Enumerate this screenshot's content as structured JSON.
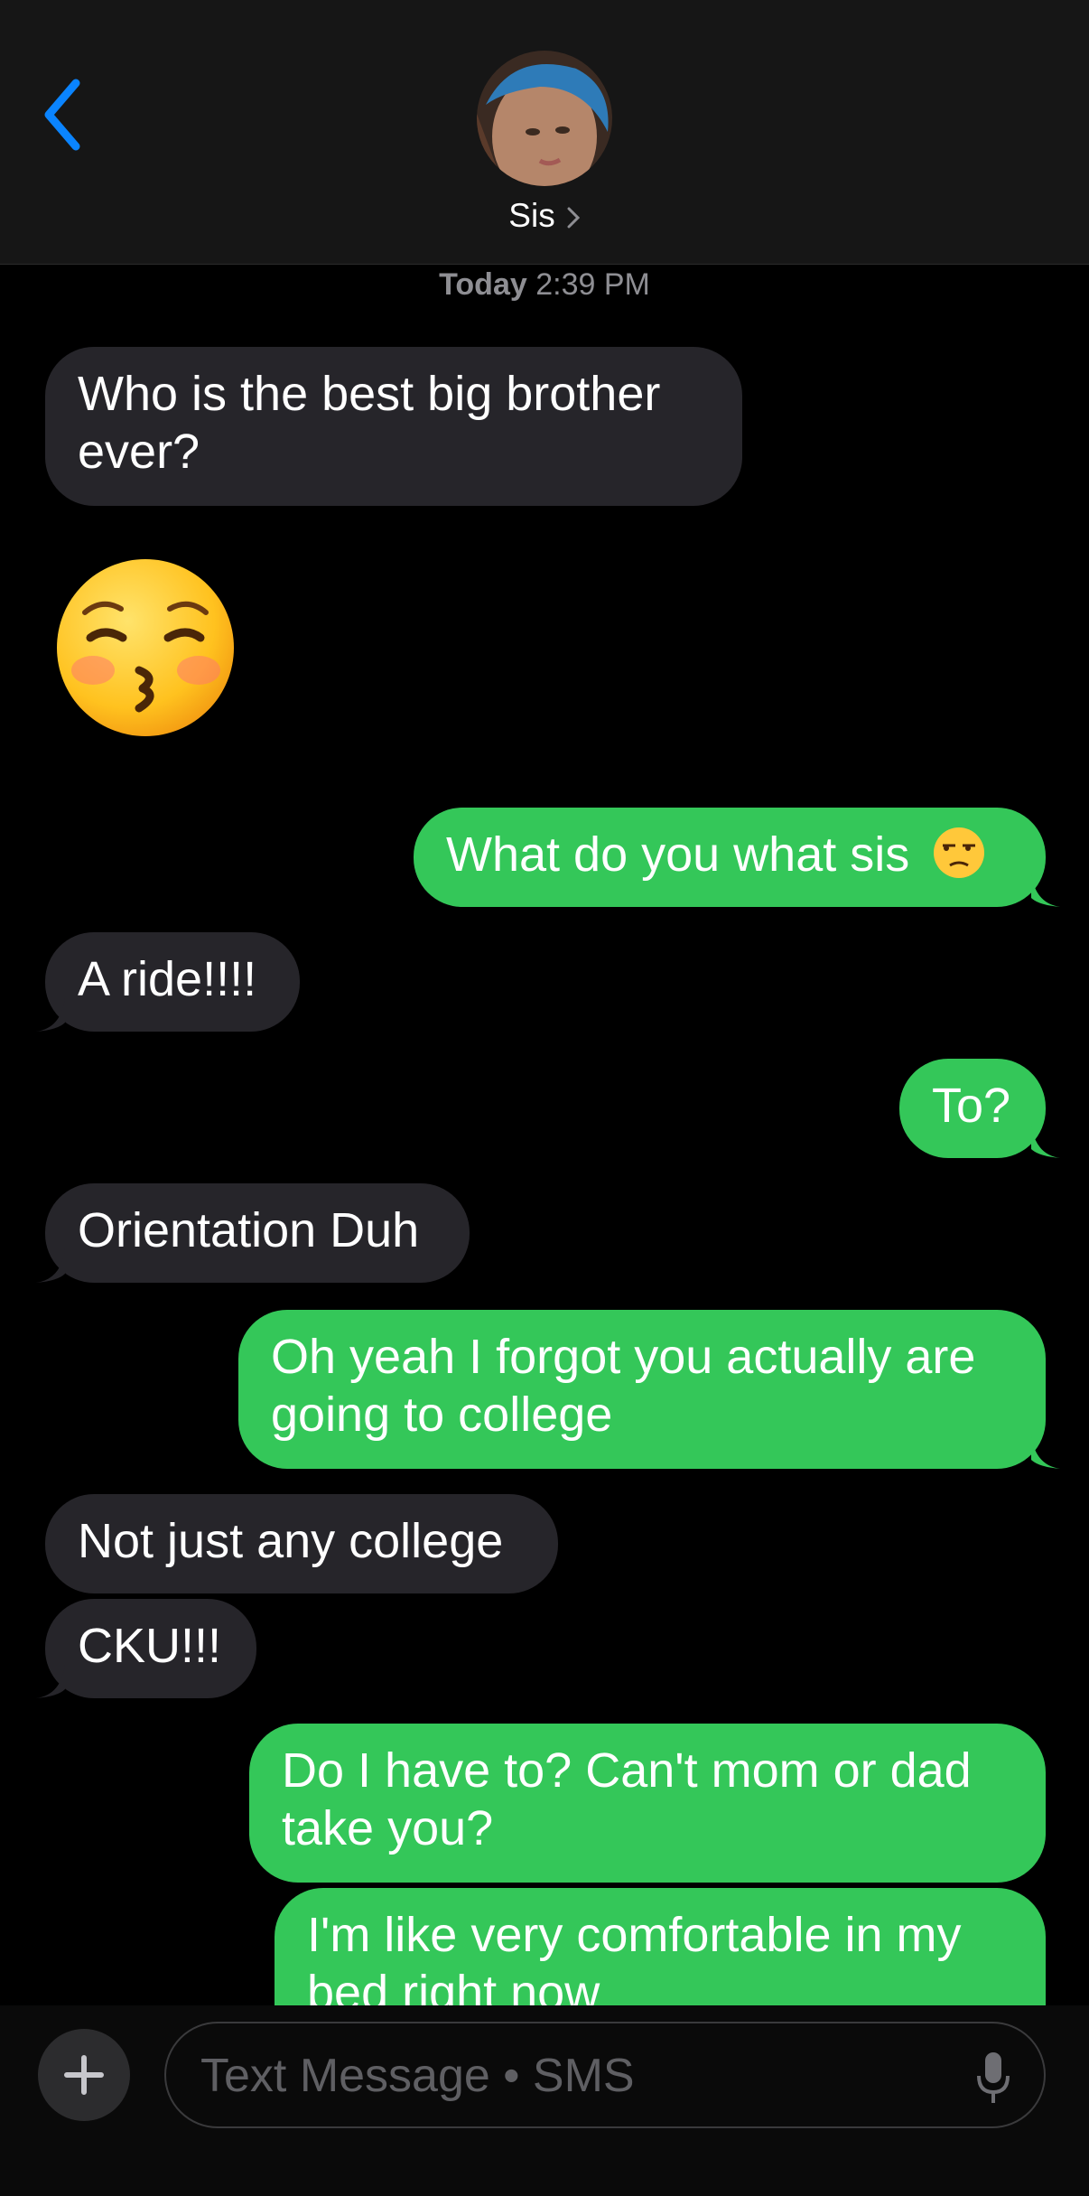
{
  "header": {
    "contact_name": "Sis",
    "back_icon": "chevron-left-icon",
    "accent": "#0a84ff"
  },
  "timestamp": {
    "day": "Today",
    "time": "2:39 PM"
  },
  "messages": [
    {
      "from": "them",
      "text_line1": "Who is the best big brother",
      "text_line2": "ever?"
    },
    {
      "from": "them",
      "emoji": "kissing-face-with-closed-eyes"
    },
    {
      "from": "me",
      "text": "What do you what sis",
      "emoji": "unamused-face"
    },
    {
      "from": "them",
      "text": "A ride!!!!"
    },
    {
      "from": "me",
      "text": "To?"
    },
    {
      "from": "them",
      "text": "Orientation Duh"
    },
    {
      "from": "me",
      "text_line1": "Oh yeah I forgot you actually are",
      "text_line2": "going to college"
    },
    {
      "from": "them",
      "text": "Not just any college"
    },
    {
      "from": "them",
      "text": "CKU!!!"
    },
    {
      "from": "me",
      "text_line1": "Do I have to? Can't mom or dad",
      "text_line2": "take you?"
    },
    {
      "from": "me",
      "text_line1": "I'm like very comfortable in my",
      "text_line2": "bed right now"
    }
  ],
  "composer": {
    "placeholder": "Text Message • SMS",
    "plus_icon": "plus-icon",
    "mic_icon": "microphone-icon"
  },
  "colors": {
    "incoming": "#26252a",
    "outgoing": "#34c759",
    "background": "#000000"
  }
}
